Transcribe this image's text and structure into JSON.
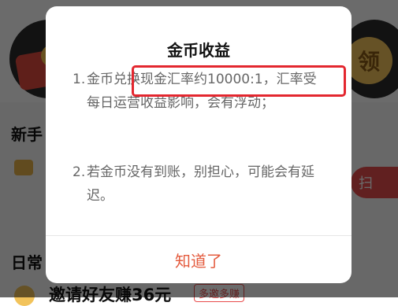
{
  "background": {
    "right_coin_char": "领",
    "section_newbie": "新手",
    "scan_button_label": "扫",
    "section_daily": "日常",
    "invite_text": "邀请好友赚36元",
    "invite_badge": "多邀多赚"
  },
  "dialog": {
    "title": "金币收益",
    "rules": [
      {
        "num": "1.",
        "text": "金币兑换现金汇率约10000:1，汇率受每日运营收益影响，会有浮动；"
      },
      {
        "num": "2.",
        "text": "若金币没有到账，别担心，可能会有延迟。"
      }
    ],
    "ok_label": "知道了"
  },
  "colors": {
    "highlight_border": "#e3272f",
    "ok_text": "#e45c3f"
  }
}
